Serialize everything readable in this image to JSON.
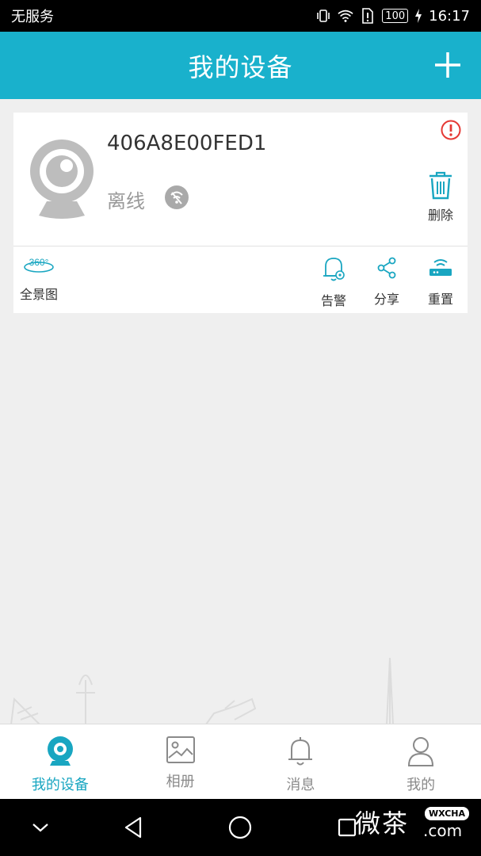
{
  "status_bar": {
    "carrier": "无服务",
    "battery": "100",
    "time": "16:17"
  },
  "header": {
    "title": "我的设备"
  },
  "device": {
    "id": "406A8E00FED1",
    "status": "离线",
    "delete_label": "删除"
  },
  "actions": {
    "panorama_label": "全景图",
    "panorama_badge": "360°",
    "alarm_label": "告警",
    "share_label": "分享",
    "reset_label": "重置"
  },
  "tabs": [
    {
      "label": "我的设备",
      "active": true
    },
    {
      "label": "相册",
      "active": false
    },
    {
      "label": "消息",
      "active": false
    },
    {
      "label": "我的",
      "active": false
    }
  ],
  "watermark": {
    "text": "微茶",
    "badge": "WXCHA",
    "domain": ".com"
  },
  "colors": {
    "accent": "#19b1cc",
    "tab_active": "#19a6c1",
    "alert": "#e53935"
  }
}
